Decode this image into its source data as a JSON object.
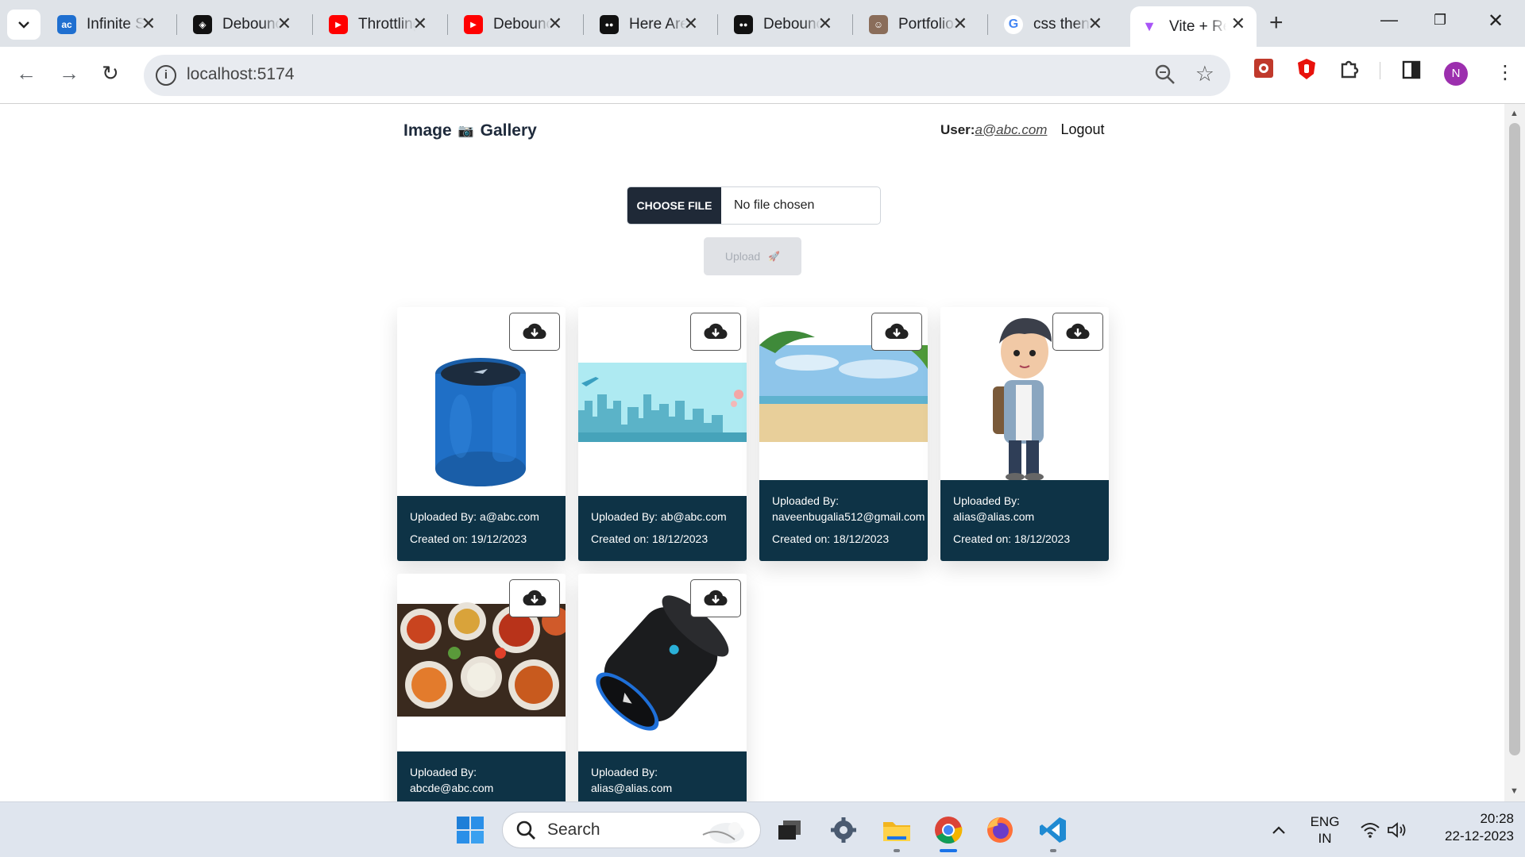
{
  "browser": {
    "tabs": [
      {
        "title": "Infinite Scroll",
        "favicon_color": "#1f6fd0",
        "favicon_text": "ac"
      },
      {
        "title": "Debouncing",
        "favicon_color": "#111111",
        "favicon_text": "◈"
      },
      {
        "title": "Throttling",
        "favicon_color": "#ff0000",
        "favicon_text": "▶"
      },
      {
        "title": "Debouncing",
        "favicon_color": "#ff0000",
        "favicon_text": "▶"
      },
      {
        "title": "Here Are",
        "favicon_color": "#111111",
        "favicon_text": "●●"
      },
      {
        "title": "Debouncing",
        "favicon_color": "#111111",
        "favicon_text": "●●"
      },
      {
        "title": "Portfolio",
        "favicon_color": "#8a6d5a",
        "favicon_text": "☺"
      },
      {
        "title": "css then",
        "favicon_color": "#ffffff",
        "favicon_text": "G"
      },
      {
        "title": "Vite + React",
        "favicon_color": "#ffffff",
        "favicon_text": "▼",
        "active": true
      }
    ],
    "address": "localhost:5174",
    "profile_initial": "N"
  },
  "header": {
    "brand_left": "Image",
    "brand_icon": "📷",
    "brand_right": "Gallery",
    "user_label": "User:",
    "user_email": "a@abc.com",
    "logout_label": "Logout"
  },
  "upload": {
    "choose_label": "CHOOSE FILE",
    "file_status": "No file chosen",
    "upload_label": "Upload",
    "upload_icon": "🚀"
  },
  "gallery": {
    "cards": [
      {
        "image": "blue speaker",
        "uploaded_by_line1": "Uploaded By: a@abc.com",
        "uploaded_by_line2": "",
        "created": "Created on: 19/12/2023"
      },
      {
        "image": "city skyline",
        "uploaded_by_line1": "Uploaded By: ab@abc.com",
        "uploaded_by_line2": "",
        "created": "Created on: 18/12/2023"
      },
      {
        "image": "beach",
        "uploaded_by_line1": "Uploaded By:",
        "uploaded_by_line2": "naveenbugalia512@gmail.com",
        "created": "Created on: 18/12/2023"
      },
      {
        "image": "cartoon boy",
        "uploaded_by_line1": "Uploaded By:",
        "uploaded_by_line2": "alias@alias.com",
        "created": "Created on: 18/12/2023"
      },
      {
        "image": "food platter",
        "uploaded_by_line1": "Uploaded By:",
        "uploaded_by_line2": "abcde@abc.com",
        "created": ""
      },
      {
        "image": "black speaker",
        "uploaded_by_line1": "Uploaded By:",
        "uploaded_by_line2": "alias@alias.com",
        "created": ""
      }
    ]
  },
  "taskbar": {
    "search_label": "Search",
    "lang_line1": "ENG",
    "lang_line2": "IN",
    "time": "20:28",
    "date": "22-12-2023"
  }
}
